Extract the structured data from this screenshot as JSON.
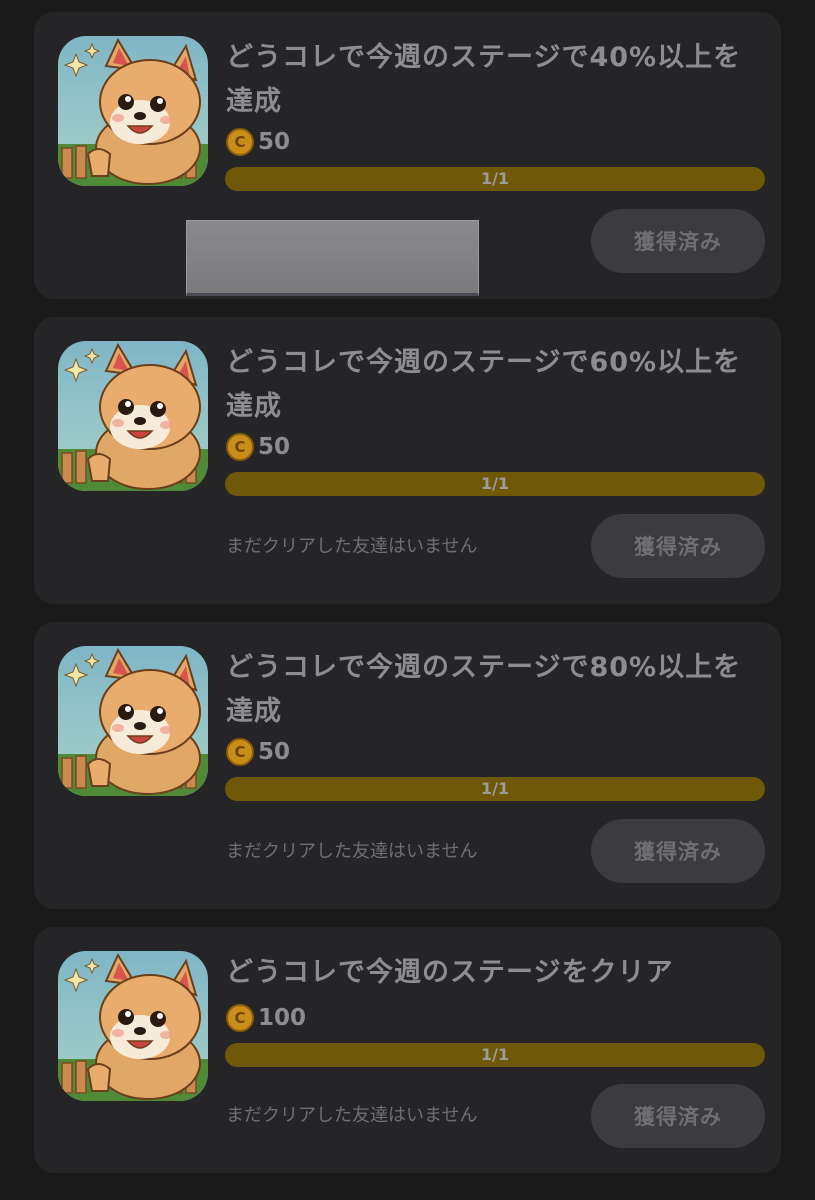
{
  "missions": [
    {
      "title": "どうコレで今週のステージで40%以上を達成",
      "reward": "50",
      "progress_text": "1/1",
      "progress": 1.0,
      "friends_text": "",
      "claim_label": "獲得済み"
    },
    {
      "title": "どうコレで今週のステージで60%以上を達成",
      "reward": "50",
      "progress_text": "1/1",
      "progress": 1.0,
      "friends_text": "まだクリアした友達はいません",
      "claim_label": "獲得済み"
    },
    {
      "title": "どうコレで今週のステージで80%以上を達成",
      "reward": "50",
      "progress_text": "1/1",
      "progress": 1.0,
      "friends_text": "まだクリアした友達はいません",
      "claim_label": "獲得済み"
    },
    {
      "title": "どうコレで今週のステージをクリア",
      "reward": "100",
      "progress_text": "1/1",
      "progress": 1.0,
      "friends_text": "まだクリアした友達はいません",
      "claim_label": "獲得済み"
    }
  ],
  "coin_symbol": "C",
  "icon_name": "pomeranian-dog-app-icon",
  "colors": {
    "background": "#1a1a1b",
    "card": "#252527",
    "progress_fill": "#6f5908",
    "coin": "#c98e1a"
  }
}
